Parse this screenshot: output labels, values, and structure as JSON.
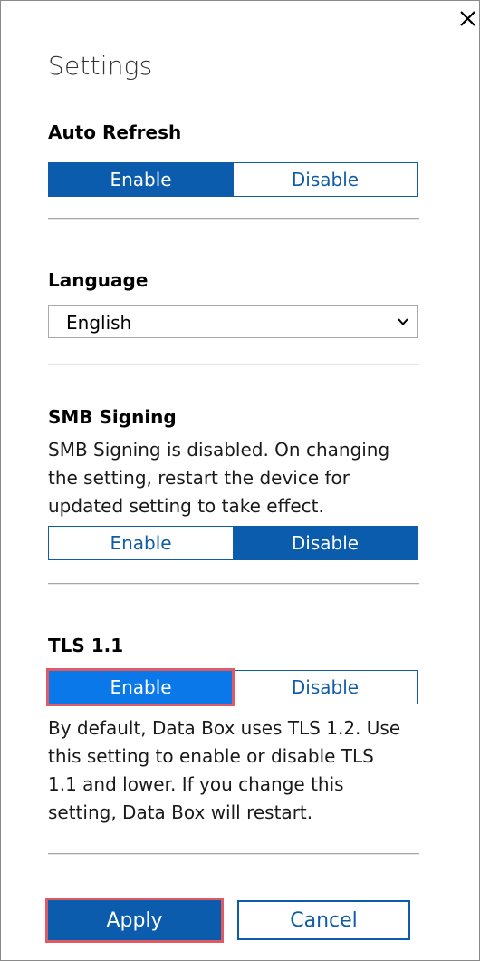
{
  "title": "Settings",
  "close_icon": "close-icon",
  "auto_refresh": {
    "heading": "Auto Refresh",
    "enable_label": "Enable",
    "disable_label": "Disable",
    "selected": "Enable"
  },
  "language": {
    "heading": "Language",
    "selected_value": "English",
    "dropdown_icon": "chevron-down-icon"
  },
  "smb_signing": {
    "heading": "SMB Signing",
    "description": "SMB Signing is disabled. On changing\nthe setting, restart the device for\nupdated setting to take effect.",
    "enable_label": "Enable",
    "disable_label": "Disable",
    "selected": "Disable"
  },
  "tls": {
    "heading": "TLS 1.1",
    "enable_label": "Enable",
    "disable_label": "Disable",
    "selected": "Enable",
    "description": "By default, Data Box uses TLS 1.2. Use\nthis setting to enable or disable TLS\n1.1 and lower. If you change this\nsetting, Data Box will restart."
  },
  "actions": {
    "apply_label": "Apply",
    "cancel_label": "Cancel"
  },
  "colors": {
    "accent": "#0b5cad",
    "selected_hover": "#0a78e8",
    "highlight_outline": "#e05a63",
    "divider": "#a6a6a6"
  }
}
